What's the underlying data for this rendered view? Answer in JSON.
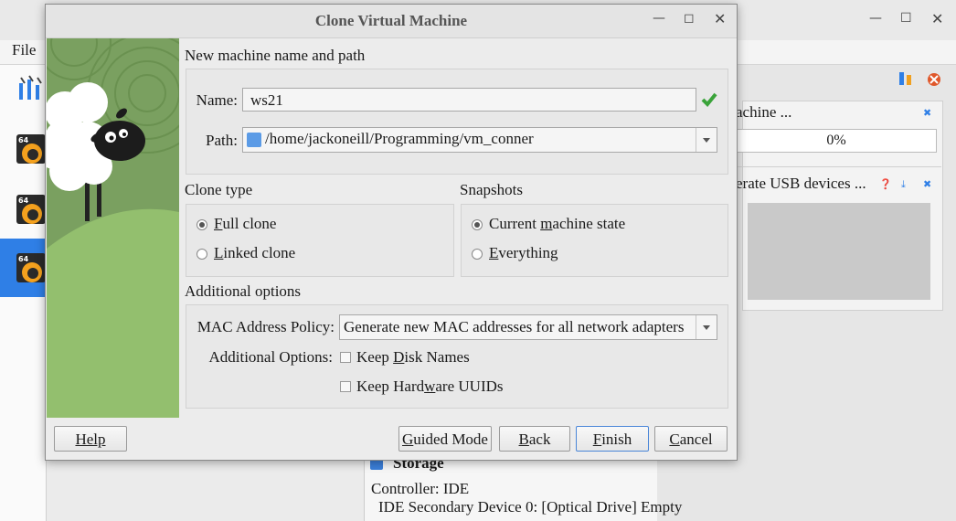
{
  "background": {
    "menu_file": "File",
    "clone_task_label": "achine ...",
    "clone_progress": "0%",
    "usb_label": "erate USB devices ...",
    "storage_title": "Storage",
    "controller": "Controller: IDE",
    "ide_device": "IDE Secondary Device 0:   [Optical Drive] Empty",
    "vm_badge": "64"
  },
  "dialog": {
    "title": "Clone Virtual Machine",
    "section_name_path": "New machine name and path",
    "name_label": "Name:",
    "name_value": "ws21",
    "path_label": "Path:",
    "path_value": "/home/jackoneill/Programming/vm_conner",
    "clone_type_title": "Clone type",
    "full_clone": "Full clone",
    "linked_clone": "Linked clone",
    "snapshots_title": "Snapshots",
    "current_state": "Current machine state",
    "everything": "Everything",
    "additional_title": "Additional options",
    "mac_policy_label": "MAC Address Policy:",
    "mac_policy_value": "Generate new MAC addresses for all network adapters",
    "additional_options_label": "Additional Options:",
    "keep_disk_names": "Keep Disk Names",
    "keep_hw_uuids": "Keep Hardware UUIDs",
    "buttons": {
      "help": "Help",
      "guided": "Guided Mode",
      "back": "Back",
      "finish": "Finish",
      "cancel": "Cancel"
    }
  },
  "state": {
    "clone_type_selected": "Full clone",
    "snapshots_selected": "Current machine state",
    "keep_disk_names": false,
    "keep_hw_uuids": false,
    "name_valid": true
  },
  "icons": [
    "minimize-icon",
    "maximize-icon",
    "close-icon",
    "checkmark-icon",
    "folder-icon",
    "dropdown-arrow-icon",
    "sheep-illustration"
  ],
  "colors": {
    "accent": "#2f7fe6",
    "valid": "#3aa33a",
    "art_green": "#8fb875"
  }
}
